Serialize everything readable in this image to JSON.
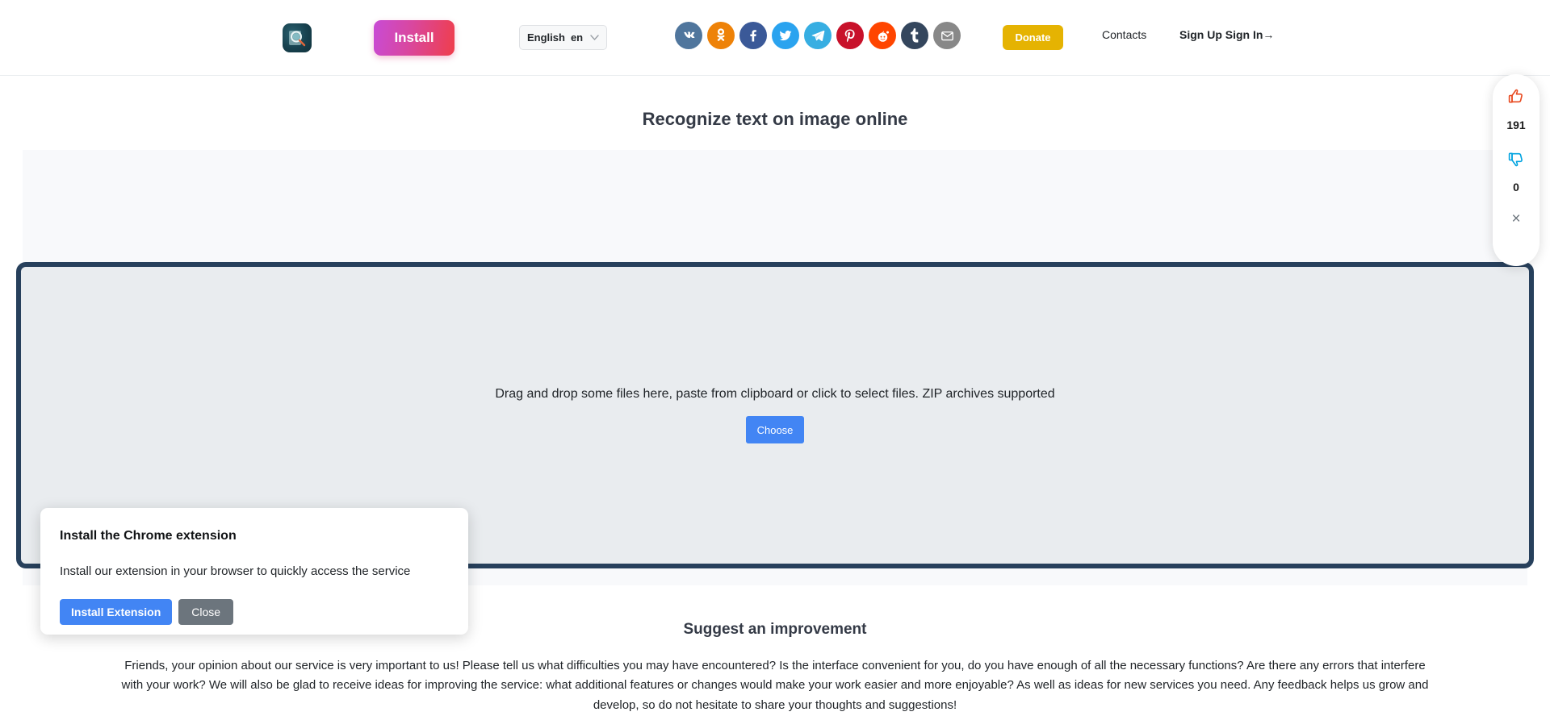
{
  "header": {
    "logo_icon": "magnifier-document-icon",
    "install_label": "Install",
    "language": {
      "name": "English",
      "code": "en",
      "chevron": "chevron-down-icon"
    },
    "socials": [
      {
        "name": "vk",
        "label": "VK",
        "color": "#50769d"
      },
      {
        "name": "odnoklassniki",
        "label": "Odnoklassniki",
        "color": "#ee8208"
      },
      {
        "name": "facebook",
        "label": "Facebook",
        "color": "#3b5998"
      },
      {
        "name": "twitter",
        "label": "Twitter",
        "color": "#2aa3ef"
      },
      {
        "name": "telegram",
        "label": "Telegram",
        "color": "#37aee2"
      },
      {
        "name": "pinterest",
        "label": "Pinterest",
        "color": "#c8112a"
      },
      {
        "name": "reddit",
        "label": "Reddit",
        "color": "#ff4500"
      },
      {
        "name": "tumblr",
        "label": "Tumblr",
        "color": "#34465d"
      },
      {
        "name": "email",
        "label": "Email",
        "color": "#888888"
      }
    ],
    "donate_label": "Donate",
    "contacts_label": "Contacts",
    "auth_label": "Sign Up Sign In→"
  },
  "page": {
    "title": "Recognize text on image online"
  },
  "dropzone": {
    "hint": "Drag and drop some files here, paste from clipboard or click to select files. ZIP archives supported",
    "choose_label": "Choose"
  },
  "vote_widget": {
    "like_icon": "thumbs-up-icon",
    "like_count": "191",
    "dislike_icon": "thumbs-down-icon",
    "dislike_count": "0",
    "close_icon": "close-icon",
    "close_glyph": "×",
    "like_color": "#e8491f",
    "dislike_color": "#00a3e0"
  },
  "extension_popup": {
    "title": "Install the Chrome extension",
    "description": "Install our extension in your browser to quickly access the service",
    "install_label": "Install Extension",
    "close_label": "Close"
  },
  "suggest": {
    "title": "Suggest an improvement",
    "body": "Friends, your opinion about our service is very important to us! Please tell us what difficulties you may have encountered? Is the interface convenient for you, do you have enough of all the necessary functions? Are there any errors that interfere with your work? We will also be glad to receive ideas for improving the service: what additional features or changes would make your work easier and more enjoyable? As well as ideas for new services you need. Any feedback helps us grow and develop, so do not hesitate to share your thoughts and suggestions!"
  },
  "theme": {
    "accent_blue": "#4285f4",
    "donate_yellow": "#e5b302",
    "dropzone_bg": "#e9ecef",
    "dropzone_border": "#27405c",
    "panel_bg": "#f8f9fb"
  }
}
